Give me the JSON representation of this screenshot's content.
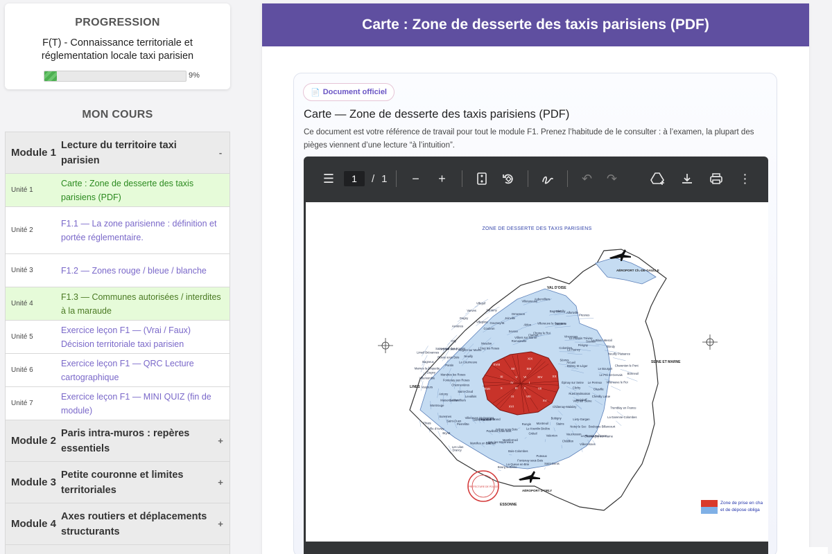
{
  "sidebar": {
    "progress": {
      "title": "PROGRESSION",
      "course": "F(T) - Connaissance territoriale et réglementation locale taxi parisien",
      "percent_label": "9%",
      "percent": 9
    },
    "course_heading": "MON COURS",
    "module1": {
      "label": "Module 1",
      "title": "Lecture du territoire taxi parisien",
      "toggle": "-"
    },
    "units": [
      {
        "label": "Unité 1",
        "title": "Carte : Zone de desserte des taxis parisiens (PDF)"
      },
      {
        "label": "Unité 2",
        "title": "F1.1 — La zone parisienne : définition et portée réglementaire."
      },
      {
        "label": "Unité 3",
        "title": "F1.2 — Zones rouge / bleue / blanche"
      },
      {
        "label": "Unité 4",
        "title": "F1.3 — Communes autorisées / interdites à la maraude"
      },
      {
        "label": "Unité 5",
        "title": "Exercice leçon F1 — (Vrai / Faux) Décision territoriale taxi parisien"
      },
      {
        "label": "Unité 6",
        "title": "Exercice leçon F1 — QRC Lecture cartographique"
      },
      {
        "label": "Unité 7",
        "title": "Exercice leçon F1 — MINI QUIZ (fin de module)"
      }
    ],
    "module2": {
      "label": "Module 2",
      "title": "Paris intra-muros : repères essentiels",
      "toggle": "+"
    },
    "module3": {
      "label": "Module 3",
      "title": "Petite couronne et limites territoriales",
      "toggle": "+"
    },
    "module4": {
      "label": "Module 4",
      "title": "Axes routiers et déplacements structurants",
      "toggle": "+"
    }
  },
  "main": {
    "banner_title": "Carte : Zone de desserte des taxis parisiens (PDF)",
    "badge": "Document officiel",
    "doc_title": "Carte — Zone de desserte des taxis parisiens (PDF)",
    "doc_desc": "Ce document est votre référence de travail pour tout le module F1. Prenez l’habitude de le consulter : à l’examen, la plupart des pièges viennent d’une lecture “à l’intuition”.",
    "viewer": {
      "page_current": "1",
      "page_sep": "/",
      "page_total": "1",
      "map_title": "ZONE DE DESSERTE DES TAXIS PARISIENS",
      "legend_line1": "Zone de prise en cha",
      "legend_line2": "et de dépose obliga",
      "labels": {
        "val_doise": "VAL D'OISE",
        "seine_marne": "SEINE ET MARNE",
        "yvelines": "LINES",
        "essonne": "ESSONNE",
        "cdg": "AÉROPORT Ch.-DE-GAULLE",
        "orly": "AÉROPORT D'ORLY",
        "stamp": "PRÉFECTURE DE POLICE"
      },
      "communes": [
        "Épinay sur Seine",
        "Pierrefitte",
        "Villetaneuse",
        "Stains",
        "Dugny",
        "Le Blanc-Mesnil",
        "Aulnay sous Bois",
        "Villepinte",
        "Tremblay en France",
        "Gennevilliers",
        "Villeneuve la Garenne",
        "Saint-Denis",
        "La Courneuve",
        "Le Bourget",
        "Drancy",
        "Sevran",
        "Livry-Gargan",
        "Vaujours",
        "Colombes",
        "Bois-Colombes",
        "Asnières",
        "Clichy",
        "Saint-Ouen",
        "Aubervilliers",
        "Bobigny",
        "Pantin",
        "Bondy",
        "Pavillons sous Bois",
        "Coubron",
        "La Garenne-Colombes",
        "Levallois",
        "Nanterre",
        "Puteaux",
        "Neuilly",
        "Le Pré St-Gervais",
        "Les Lilas",
        "Romainville",
        "Noisy le Sec",
        "Villemomble",
        "Le Raincy",
        "Montfermeil",
        "Gagny",
        "Rueil Malmaison",
        "Suresnes",
        "Bagnolet",
        "Montreuil",
        "Rosny sous Bois",
        "Neuilly Plaisance",
        "Noisy le Grand",
        "Gournay/M.",
        "Boulogne Billancourt",
        "Saint-Cloud",
        "Vincennes",
        "Fontenay sous Bois",
        "Nogent sur Marne",
        "Le Perreux",
        "Bry/M.",
        "Villiers sur Marne",
        "Vaucresson",
        "Marnes la Coquette",
        "Sèvres",
        "Issy les Moulineaux",
        "Vanves",
        "Malakoff",
        "Montrouge",
        "Gentilly",
        "Le Kremlin Bicêtre",
        "Ivry sur Seine",
        "Charenton le Pont",
        "Saint-Maurice",
        "Joinville",
        "Champigny sur Marne",
        "Chennevières",
        "Le Plessis Trévise",
        "La Queue en Brie",
        "Meudon",
        "Chaville",
        "Ville d'Avray",
        "Clamart",
        "Châtillon",
        "Bagneux",
        "Arcueil",
        "Cachan",
        "Villejuif",
        "Vitry sur Seine",
        "Maisons Alfort",
        "Alfortville",
        "Créteil",
        "Saint-Maur des Fossés",
        "Bonneuil",
        "Sucy en Brie",
        "Ormesson",
        "Le Plessis Robinson",
        "Fontenay aux Roses",
        "Sceaux",
        "Bourg la Reine",
        "L'Haÿ les Roses",
        "Chevilly Larue",
        "Thiais",
        "Choisy le Roi",
        "Valenton",
        "Limeil Brévannes",
        "Boissy St-Léger",
        "Marolles en Brie",
        "Santeny",
        "Châtenay-Malabry",
        "Antony",
        "Fresnes",
        "Rungis",
        "Orly",
        "Villeneuve le Roi",
        "Villeneuve St-Georges",
        "Ablon",
        "Villecresnes",
        "Mandres les Roses",
        "Périgny"
      ],
      "arrondissements": [
        "I",
        "II",
        "III",
        "IV",
        "V",
        "VI",
        "VII",
        "VIII",
        "IX",
        "X",
        "XI",
        "XII",
        "XIII",
        "XIV",
        "XV",
        "XVI",
        "XVII",
        "XVIII",
        "XIX",
        "XX"
      ]
    }
  }
}
